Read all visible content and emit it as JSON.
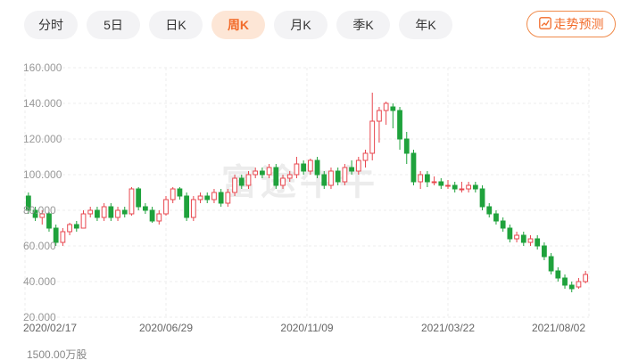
{
  "tabs": [
    {
      "label": "分时",
      "active": false
    },
    {
      "label": "5日",
      "active": false
    },
    {
      "label": "日K",
      "active": false
    },
    {
      "label": "周K",
      "active": true
    },
    {
      "label": "月K",
      "active": false
    },
    {
      "label": "季K",
      "active": false
    },
    {
      "label": "年K",
      "active": false
    }
  ],
  "forecast_button": {
    "label": "走势预测",
    "icon": "trend-up-icon"
  },
  "watermark": "富途牛牛",
  "volume_label": "1500.00万股",
  "colors": {
    "up": "#e8474f",
    "down": "#1fa23c",
    "accent": "#f26b2a"
  },
  "chart_data": {
    "type": "candlestick",
    "y_ticks": [
      "160.000",
      "140.000",
      "120.000",
      "100.000",
      "80.000",
      "60.000",
      "40.000",
      "20.000"
    ],
    "ylim": [
      20,
      160
    ],
    "x_ticks": [
      "2020/02/17",
      "2020/06/29",
      "2020/11/09",
      "2021/03/22",
      "2021/08/02"
    ],
    "candles": [
      [
        88,
        80,
        90,
        78
      ],
      [
        80,
        76,
        82,
        74
      ],
      [
        76,
        78,
        80,
        72
      ],
      [
        78,
        70,
        79,
        68
      ],
      [
        70,
        62,
        72,
        60
      ],
      [
        62,
        68,
        70,
        60
      ],
      [
        68,
        72,
        73,
        66
      ],
      [
        72,
        70,
        74,
        68
      ],
      [
        70,
        78,
        80,
        70
      ],
      [
        78,
        80,
        82,
        76
      ],
      [
        80,
        76,
        82,
        74
      ],
      [
        76,
        82,
        84,
        74
      ],
      [
        82,
        76,
        84,
        74
      ],
      [
        76,
        80,
        82,
        74
      ],
      [
        80,
        78,
        82,
        76
      ],
      [
        78,
        92,
        93,
        77
      ],
      [
        92,
        82,
        93,
        80
      ],
      [
        82,
        80,
        84,
        78
      ],
      [
        80,
        74,
        82,
        73
      ],
      [
        74,
        78,
        80,
        72
      ],
      [
        78,
        86,
        88,
        77
      ],
      [
        86,
        92,
        93,
        84
      ],
      [
        92,
        88,
        93,
        86
      ],
      [
        88,
        76,
        90,
        74
      ],
      [
        76,
        86,
        88,
        74
      ],
      [
        86,
        88,
        90,
        84
      ],
      [
        88,
        86,
        90,
        84
      ],
      [
        86,
        90,
        92,
        84
      ],
      [
        90,
        84,
        92,
        82
      ],
      [
        84,
        90,
        92,
        82
      ],
      [
        90,
        98,
        100,
        88
      ],
      [
        98,
        94,
        100,
        92
      ],
      [
        94,
        100,
        102,
        92
      ],
      [
        100,
        102,
        104,
        98
      ],
      [
        102,
        100,
        104,
        98
      ],
      [
        100,
        104,
        106,
        98
      ],
      [
        104,
        94,
        106,
        92
      ],
      [
        94,
        98,
        100,
        92
      ],
      [
        98,
        100,
        102,
        96
      ],
      [
        100,
        106,
        110,
        98
      ],
      [
        106,
        102,
        108,
        100
      ],
      [
        102,
        108,
        109,
        100
      ],
      [
        108,
        100,
        110,
        98
      ],
      [
        100,
        94,
        102,
        92
      ],
      [
        94,
        102,
        104,
        92
      ],
      [
        102,
        96,
        104,
        94
      ],
      [
        96,
        104,
        106,
        94
      ],
      [
        104,
        102,
        108,
        100
      ],
      [
        102,
        108,
        110,
        100
      ],
      [
        108,
        112,
        114,
        104
      ],
      [
        112,
        130,
        146,
        108
      ],
      [
        130,
        136,
        138,
        118
      ],
      [
        136,
        140,
        141,
        128
      ],
      [
        138,
        136,
        140,
        126
      ],
      [
        136,
        120,
        138,
        114
      ],
      [
        120,
        112,
        124,
        106
      ],
      [
        112,
        96,
        114,
        94
      ],
      [
        96,
        100,
        102,
        92
      ],
      [
        100,
        96,
        102,
        93
      ],
      [
        96,
        96,
        99,
        94
      ],
      [
        96,
        94,
        98,
        92
      ],
      [
        94,
        94,
        97,
        92
      ],
      [
        94,
        92,
        96,
        90
      ],
      [
        92,
        92,
        96,
        90
      ],
      [
        92,
        94,
        96,
        90
      ],
      [
        94,
        92,
        96,
        90
      ],
      [
        92,
        82,
        94,
        80
      ],
      [
        82,
        78,
        84,
        76
      ],
      [
        78,
        74,
        80,
        72
      ],
      [
        74,
        70,
        76,
        68
      ],
      [
        70,
        64,
        72,
        62
      ],
      [
        64,
        66,
        68,
        62
      ],
      [
        66,
        62,
        68,
        60
      ],
      [
        62,
        64,
        66,
        60
      ],
      [
        64,
        60,
        66,
        58
      ],
      [
        60,
        54,
        62,
        52
      ],
      [
        54,
        46,
        56,
        44
      ],
      [
        46,
        42,
        48,
        40
      ],
      [
        42,
        38,
        44,
        36
      ],
      [
        38,
        36,
        40,
        34
      ],
      [
        37,
        40,
        42,
        36
      ],
      [
        40,
        44,
        46,
        39
      ]
    ]
  }
}
